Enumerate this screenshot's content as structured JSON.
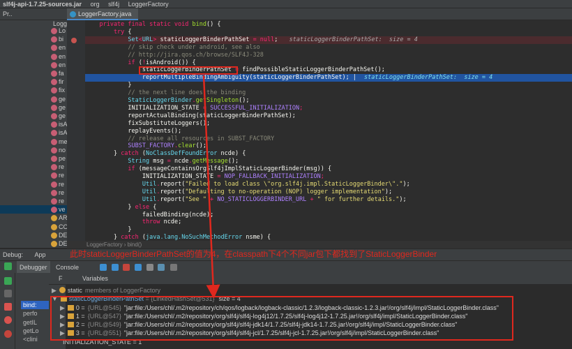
{
  "breadcrumb": [
    "slf4j-api-1.7.25-sources.jar",
    "org",
    "slf4j",
    "LoggerFactory"
  ],
  "project_tab": "Pr..",
  "file_tab": "LoggerFactory.java",
  "sidebar": {
    "root": "Logg",
    "items": [
      {
        "label": "Lo",
        "kind": "method"
      },
      {
        "label": "bi",
        "kind": "method"
      },
      {
        "label": "en",
        "kind": "method"
      },
      {
        "label": "en",
        "kind": "method"
      },
      {
        "label": "en",
        "kind": "method"
      },
      {
        "label": "fa",
        "kind": "method"
      },
      {
        "label": "fir",
        "kind": "method"
      },
      {
        "label": "fix",
        "kind": "method"
      },
      {
        "label": "ge",
        "kind": "method"
      },
      {
        "label": "ge",
        "kind": "method"
      },
      {
        "label": "ge",
        "kind": "method"
      },
      {
        "label": "isA",
        "kind": "method"
      },
      {
        "label": "isA",
        "kind": "method"
      },
      {
        "label": "me",
        "kind": "method"
      },
      {
        "label": "no",
        "kind": "method"
      },
      {
        "label": "pe",
        "kind": "method"
      },
      {
        "label": "re",
        "kind": "method"
      },
      {
        "label": "re",
        "kind": "method"
      },
      {
        "label": "re",
        "kind": "method"
      },
      {
        "label": "re",
        "kind": "method"
      },
      {
        "label": "re",
        "kind": "method"
      },
      {
        "label": "ve",
        "kind": "method",
        "selected": true
      },
      {
        "label": "AR",
        "kind": "field"
      },
      {
        "label": "CO",
        "kind": "field"
      },
      {
        "label": "DE",
        "kind": "field"
      },
      {
        "label": "DE",
        "kind": "field"
      }
    ]
  },
  "code": [
    {
      "tokens": [
        [
          "k",
          "    private final static void "
        ],
        [
          "m",
          "bind"
        ],
        [
          "n",
          "() {"
        ]
      ]
    },
    {
      "tokens": [
        [
          "k",
          "        try "
        ],
        [
          "n",
          "{"
        ]
      ]
    },
    {
      "state": "breakpoint",
      "tokens": [
        [
          "t",
          "            Set"
        ],
        [
          "k",
          "<"
        ],
        [
          "t",
          "URL"
        ],
        [
          "k",
          "> "
        ],
        [
          "n",
          "staticLoggerBinderPathSet "
        ],
        [
          "k",
          "= null"
        ],
        [
          "n",
          ";  "
        ]
      ],
      "hint": "staticLoggerBinderPathSet:  size = 4"
    },
    {
      "tokens": [
        [
          "c",
          "            // skip check under android, see also"
        ]
      ]
    },
    {
      "tokens": [
        [
          "c",
          "            // http://jira.qos.ch/browse/SLF4J-328"
        ]
      ]
    },
    {
      "tokens": [
        [
          "k",
          "            if "
        ],
        [
          "n",
          "("
        ],
        [
          "k",
          "!"
        ],
        [
          "n",
          "isAndroid()) {"
        ]
      ]
    },
    {
      "tokens": [
        [
          "n",
          "                staticLoggerBinderPathSet "
        ],
        [
          "k",
          "= "
        ],
        [
          "n",
          "findPossibleStaticLoggerBinderPathSet();"
        ]
      ]
    },
    {
      "state": "exec",
      "tokens": [
        [
          "n",
          "                reportMultipleBindingAmbiguity(staticLoggerBinderPathSet); | "
        ]
      ],
      "hint": "staticLoggerBinderPathSet:  size = 4"
    },
    {
      "tokens": [
        [
          "n",
          "            }"
        ]
      ]
    },
    {
      "tokens": [
        [
          "c",
          "            // the next line does the binding"
        ]
      ]
    },
    {
      "tokens": [
        [
          "t",
          "            StaticLoggerBinder"
        ],
        [
          "k",
          "."
        ],
        [
          "m",
          "getSingleton"
        ],
        [
          "n",
          "();"
        ]
      ]
    },
    {
      "tokens": [
        [
          "n",
          "            INITIALIZATION_STATE "
        ],
        [
          "k",
          "= "
        ],
        [
          "p",
          "SUCCESSFUL_INITIALIZATION"
        ],
        [
          "k",
          ";"
        ]
      ]
    },
    {
      "tokens": [
        [
          "n",
          "            reportActualBinding(staticLoggerBinderPathSet);"
        ]
      ]
    },
    {
      "tokens": [
        [
          "n",
          "            fixSubstituteLoggers();"
        ]
      ]
    },
    {
      "tokens": [
        [
          "n",
          "            replayEvents();"
        ]
      ]
    },
    {
      "tokens": [
        [
          "c",
          "            // release all resources in SUBST_FACTORY"
        ]
      ]
    },
    {
      "tokens": [
        [
          "p",
          "            SUBST_FACTORY"
        ],
        [
          "k",
          "."
        ],
        [
          "m",
          "clear"
        ],
        [
          "n",
          "();"
        ]
      ]
    },
    {
      "tokens": [
        [
          "n",
          "        } "
        ],
        [
          "k",
          "catch "
        ],
        [
          "n",
          "("
        ],
        [
          "t",
          "NoClassDefFoundError "
        ],
        [
          "n",
          "ncde) {"
        ]
      ]
    },
    {
      "tokens": [
        [
          "t",
          "            String "
        ],
        [
          "n",
          "msg "
        ],
        [
          "k",
          "= "
        ],
        [
          "n",
          "ncde"
        ],
        [
          "k",
          "."
        ],
        [
          "m",
          "getMessage"
        ],
        [
          "n",
          "();"
        ]
      ]
    },
    {
      "tokens": [
        [
          "k",
          "            if "
        ],
        [
          "n",
          "(messageContainsOrgSlf4jImplStaticLoggerBinder(msg)) {"
        ]
      ]
    },
    {
      "tokens": [
        [
          "n",
          "                INITIALIZATION_STATE "
        ],
        [
          "k",
          "= "
        ],
        [
          "p",
          "NOP_FALLBACK_INITIALIZATION"
        ],
        [
          "k",
          ";"
        ]
      ]
    },
    {
      "tokens": [
        [
          "t",
          "                Util"
        ],
        [
          "k",
          "."
        ],
        [
          "n",
          "report("
        ],
        [
          "s",
          "\"Failed to load class \\\"org.slf4j.impl.StaticLoggerBinder\\\".\""
        ],
        [
          "n",
          ");"
        ]
      ]
    },
    {
      "tokens": [
        [
          "t",
          "                Util"
        ],
        [
          "k",
          "."
        ],
        [
          "n",
          "report("
        ],
        [
          "s",
          "\"Defaulting to no-operation (NOP) logger implementation\""
        ],
        [
          "n",
          ");"
        ]
      ]
    },
    {
      "tokens": [
        [
          "t",
          "                Util"
        ],
        [
          "k",
          "."
        ],
        [
          "n",
          "report("
        ],
        [
          "s",
          "\"See \" "
        ],
        [
          "k",
          "+ "
        ],
        [
          "p",
          "NO_STATICLOGGERBINDER_URL "
        ],
        [
          "k",
          "+ "
        ],
        [
          "s",
          "\" for further details.\""
        ],
        [
          "n",
          ");"
        ]
      ]
    },
    {
      "tokens": [
        [
          "n",
          "            } "
        ],
        [
          "k",
          "else "
        ],
        [
          "n",
          "{"
        ]
      ]
    },
    {
      "tokens": [
        [
          "n",
          "                failedBinding(ncde);"
        ]
      ]
    },
    {
      "tokens": [
        [
          "k",
          "                throw "
        ],
        [
          "n",
          "ncde;"
        ]
      ]
    },
    {
      "tokens": [
        [
          "n",
          "            }"
        ]
      ]
    },
    {
      "tokens": [
        [
          "n",
          "        } "
        ],
        [
          "k",
          "catch "
        ],
        [
          "n",
          "("
        ],
        [
          "t",
          "java.lang.NoSuchMethodError "
        ],
        [
          "n",
          "nsme) {"
        ]
      ]
    }
  ],
  "editor_breadcrumb": "LoggerFactory  ›  bind()",
  "debug": {
    "label": "Debug:",
    "config": "App",
    "tabs": [
      "Debugger",
      "Console"
    ],
    "frames_label": "F",
    "variables_label": "Variables",
    "frames": [
      "bind:",
      "perfo",
      "getIL",
      "getLo",
      "<clini"
    ],
    "annotation": "此时staticLoggerBinderPathSet的值为4，在classpath下4个不同jar包下都找到了StaticLoggerBinder",
    "variables": {
      "static_row": {
        "name": "static",
        "rest": "members of LoggerFactory"
      },
      "set": {
        "name": "staticLoggerBinderPathSet",
        "ref": " = {LinkedHashSet@531}",
        "size": "size = 4"
      },
      "entries": [
        {
          "index": "0",
          "ref": "{URL@545}",
          "value": "\"jar:file:/Users/chl/.m2/repository/ch/qos/logback/logback-classic/1.2.3/logback-classic-1.2.3.jar!/org/slf4j/impl/StaticLoggerBinder.class\""
        },
        {
          "index": "1",
          "ref": "{URL@547}",
          "value": "\"jar:file:/Users/chl/.m2/repository/org/slf4j/slf4j-log4j12/1.7.25/slf4j-log4j12-1.7.25.jar!/org/slf4j/impl/StaticLoggerBinder.class\""
        },
        {
          "index": "2",
          "ref": "{URL@549}",
          "value": "\"jar:file:/Users/chl/.m2/repository/org/slf4j/slf4j-jdk14/1.7.25/slf4j-jdk14-1.7.25.jar!/org/slf4j/impl/StaticLoggerBinder.class\""
        },
        {
          "index": "3",
          "ref": "{URL@551}",
          "value": "\"jar:file:/Users/chl/.m2/repository/org/slf4j/slf4j-jcl/1.7.25/slf4j-jcl-1.7.25.jar!/org/slf4j/impl/StaticLoggerBinder.class\""
        }
      ],
      "last_row": "INITIALIZATION_STATE = 1"
    }
  },
  "colors": {
    "annotation": "#e0281e",
    "exec_line": "#2154a0",
    "breakpoint_line": "#4b2b2e"
  }
}
